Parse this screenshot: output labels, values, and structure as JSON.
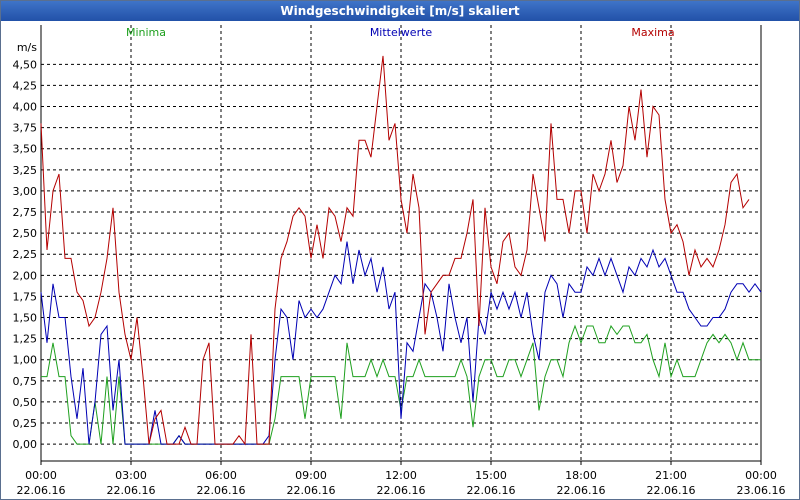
{
  "window": {
    "title": "Windgeschwindigkeit [m/s] skaliert"
  },
  "chart_data": {
    "type": "line",
    "title": "Windgeschwindigkeit [m/s] skaliert",
    "ylabel": "m/s",
    "xlabel": "",
    "ylim": [
      -0.2,
      4.8
    ],
    "yticks": [
      "0,00",
      "0,25",
      "0,50",
      "0,75",
      "1,00",
      "1,25",
      "1,50",
      "1,75",
      "2,00",
      "2,25",
      "2,50",
      "2,75",
      "3,00",
      "3,25",
      "3,50",
      "3,75",
      "4,00",
      "4,25",
      "4,50"
    ],
    "xticks": [
      {
        "time": "00:00",
        "date": "22.06.16"
      },
      {
        "time": "03:00",
        "date": "22.06.16"
      },
      {
        "time": "06:00",
        "date": "22.06.16"
      },
      {
        "time": "09:00",
        "date": "22.06.16"
      },
      {
        "time": "12:00",
        "date": "22.06.16"
      },
      {
        "time": "15:00",
        "date": "22.06.16"
      },
      {
        "time": "18:00",
        "date": "22.06.16"
      },
      {
        "time": "21:00",
        "date": "22.06.16"
      },
      {
        "time": "00:00",
        "date": "23.06.16"
      }
    ],
    "x_hours": [
      0,
      0.2,
      0.4,
      0.6,
      0.8,
      1.0,
      1.2,
      1.4,
      1.6,
      1.8,
      2.0,
      2.2,
      2.4,
      2.6,
      2.8,
      3.0,
      3.2,
      3.4,
      3.6,
      3.8,
      4.0,
      4.2,
      4.4,
      4.6,
      4.8,
      5.0,
      5.2,
      5.4,
      5.6,
      5.8,
      6.0,
      6.2,
      6.4,
      6.6,
      6.8,
      7.0,
      7.2,
      7.4,
      7.6,
      7.8,
      8.0,
      8.2,
      8.4,
      8.6,
      8.8,
      9.0,
      9.2,
      9.4,
      9.6,
      9.8,
      10.0,
      10.2,
      10.4,
      10.6,
      10.8,
      11.0,
      11.2,
      11.4,
      11.6,
      11.8,
      12.0,
      12.2,
      12.4,
      12.6,
      12.8,
      13.0,
      13.2,
      13.4,
      13.6,
      13.8,
      14.0,
      14.2,
      14.4,
      14.6,
      14.8,
      15.0,
      15.2,
      15.4,
      15.6,
      15.8,
      16.0,
      16.2,
      16.4,
      16.6,
      16.8,
      17.0,
      17.2,
      17.4,
      17.6,
      17.8,
      18.0,
      18.2,
      18.4,
      18.6,
      18.8,
      19.0,
      19.2,
      19.4,
      19.6,
      19.8,
      20.0,
      20.2,
      20.4,
      20.6,
      20.8,
      21.0,
      21.2,
      21.4,
      21.6,
      21.8,
      22.0,
      22.2,
      22.4,
      22.6,
      22.8,
      23.0,
      23.2,
      23.4,
      23.6,
      23.8,
      24.0
    ],
    "series": [
      {
        "name": "Minima",
        "color": "#1fa01f",
        "values": [
          0.8,
          0.8,
          1.2,
          0.8,
          0.8,
          0.1,
          0.0,
          0.0,
          0.0,
          0.5,
          0.0,
          0.8,
          0.0,
          0.8,
          0.0,
          0.0,
          0.0,
          0.0,
          0.0,
          0.0,
          0.0,
          0.0,
          0.0,
          0.1,
          0.0,
          0.0,
          0.0,
          0.0,
          0.0,
          0.0,
          0.0,
          0.0,
          0.0,
          0.0,
          0.0,
          0.0,
          0.0,
          0.0,
          0.0,
          0.3,
          0.8,
          0.8,
          0.8,
          0.8,
          0.3,
          0.8,
          0.8,
          0.8,
          0.8,
          0.8,
          0.3,
          1.2,
          0.8,
          0.8,
          0.8,
          1.0,
          0.8,
          1.0,
          0.8,
          0.8,
          0.4,
          0.8,
          0.8,
          1.0,
          0.8,
          0.8,
          0.8,
          0.8,
          0.8,
          0.8,
          1.0,
          0.8,
          0.2,
          0.8,
          1.0,
          1.0,
          0.8,
          0.8,
          1.0,
          1.0,
          0.8,
          1.0,
          1.2,
          0.4,
          0.8,
          1.0,
          1.0,
          0.8,
          1.2,
          1.4,
          1.2,
          1.4,
          1.4,
          1.2,
          1.2,
          1.4,
          1.3,
          1.4,
          1.4,
          1.2,
          1.2,
          1.3,
          1.0,
          0.8,
          1.2,
          0.8,
          1.0,
          0.8,
          0.8,
          0.8,
          1.0,
          1.2,
          1.3,
          1.2,
          1.3,
          1.2,
          1.0,
          1.2,
          1.0,
          1.0,
          1.0
        ],
        "label": "Minima"
      },
      {
        "name": "Mittelwerte",
        "color": "#0000b4",
        "values": [
          1.8,
          1.2,
          1.9,
          1.5,
          1.5,
          0.8,
          0.3,
          0.9,
          0.0,
          0.5,
          1.3,
          1.4,
          0.4,
          1.0,
          0.0,
          0.0,
          0.0,
          0.0,
          0.0,
          0.4,
          0.0,
          0.0,
          0.0,
          0.1,
          0.0,
          0.0,
          0.0,
          0.0,
          0.0,
          0.0,
          0.0,
          0.0,
          0.0,
          0.0,
          0.0,
          0.0,
          0.0,
          0.0,
          0.1,
          1.0,
          1.6,
          1.5,
          1.0,
          1.7,
          1.5,
          1.6,
          1.5,
          1.6,
          1.8,
          2.0,
          1.9,
          2.4,
          1.9,
          2.3,
          2.0,
          2.2,
          1.8,
          2.1,
          1.6,
          1.8,
          0.3,
          1.2,
          1.1,
          1.5,
          1.9,
          1.8,
          1.5,
          1.1,
          1.9,
          1.5,
          1.2,
          1.5,
          0.5,
          1.5,
          1.3,
          1.8,
          1.6,
          1.8,
          1.6,
          1.8,
          1.5,
          1.8,
          1.3,
          1.0,
          1.8,
          2.0,
          1.9,
          1.5,
          1.9,
          1.8,
          1.8,
          2.1,
          2.0,
          2.2,
          2.0,
          2.2,
          2.0,
          1.8,
          2.1,
          2.0,
          2.2,
          2.1,
          2.3,
          2.1,
          2.2,
          2.0,
          1.8,
          1.8,
          1.6,
          1.5,
          1.4,
          1.4,
          1.5,
          1.5,
          1.6,
          1.8,
          1.9,
          1.9,
          1.8,
          1.9,
          1.8
        ],
        "label": "Mittelwerte"
      },
      {
        "name": "Maxima",
        "color": "#b40000",
        "values": [
          3.8,
          2.3,
          3.0,
          3.2,
          2.2,
          2.2,
          1.8,
          1.7,
          1.4,
          1.5,
          1.8,
          2.2,
          2.8,
          1.8,
          1.3,
          1.0,
          1.5,
          0.8,
          0.0,
          0.3,
          0.4,
          0.0,
          0.0,
          0.0,
          0.2,
          0.0,
          0.0,
          1.0,
          1.2,
          0.0,
          0.0,
          0.0,
          0.0,
          0.1,
          0.0,
          1.3,
          0.0,
          0.0,
          0.0,
          1.6,
          2.2,
          2.4,
          2.7,
          2.8,
          2.7,
          2.2,
          2.6,
          2.2,
          2.8,
          2.7,
          2.4,
          2.8,
          2.7,
          3.6,
          3.6,
          3.4,
          4.0,
          4.6,
          3.6,
          3.8,
          2.9,
          2.5,
          3.2,
          2.8,
          1.3,
          1.8,
          1.9,
          2.0,
          2.0,
          2.2,
          2.2,
          2.5,
          2.9,
          1.4,
          2.8,
          2.1,
          1.9,
          2.4,
          2.5,
          2.1,
          2.0,
          2.3,
          3.2,
          2.8,
          2.4,
          3.8,
          2.9,
          2.9,
          2.5,
          3.0,
          3.0,
          2.5,
          3.2,
          3.0,
          3.2,
          3.6,
          3.1,
          3.3,
          4.0,
          3.6,
          4.2,
          3.4,
          4.0,
          3.9,
          2.9,
          2.5,
          2.6,
          2.4,
          2.0,
          2.3,
          2.1,
          2.2,
          2.1,
          2.3,
          2.6,
          3.1,
          3.2,
          2.8,
          2.9
        ],
        "label": "Maxima"
      }
    ],
    "grid": true,
    "legend": "top"
  }
}
